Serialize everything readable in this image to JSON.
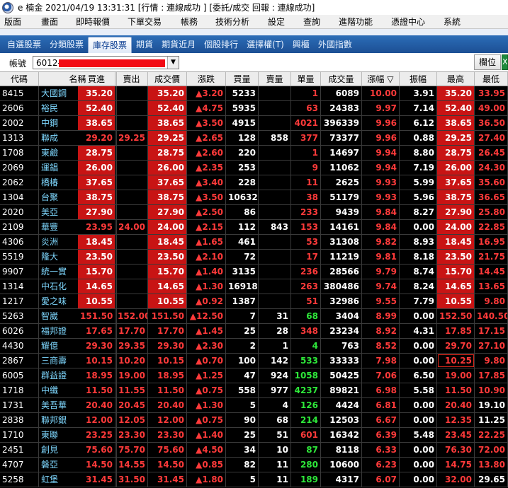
{
  "titlebar": {
    "title": "e 楠金  2021/04/19 13:31:31  [行情 : 連線成功  ] [委託/成交 回報 : 連線成功]"
  },
  "menu": [
    "版面",
    "畫面",
    "即時報價",
    "下單交易",
    "帳務",
    "技術分析",
    "設定",
    "查詢",
    "進階功能",
    "憑證中心",
    "系統"
  ],
  "tabs": [
    {
      "label": "自選股票",
      "active": false
    },
    {
      "label": "分類股票",
      "active": false
    },
    {
      "label": "庫存股票",
      "active": true
    },
    {
      "label": "期貨",
      "active": false
    },
    {
      "label": "期貨近月",
      "active": false
    },
    {
      "label": "個股排行",
      "active": false
    },
    {
      "label": "選擇權(T)",
      "active": false
    },
    {
      "label": "興櫃",
      "active": false
    },
    {
      "label": "外國指數",
      "active": false
    }
  ],
  "account": {
    "label": "帳號",
    "value": "6012-"
  },
  "toolbar": {
    "field_button": "欄位",
    "excel_glyph": "X"
  },
  "columns": [
    "代碼",
    "名稱",
    "買進",
    "賣出",
    "成交價",
    "漲跌",
    "買量",
    "賣量",
    "單量",
    "成交量",
    "漲幅 ▽",
    "振幅",
    "最高",
    "最低"
  ],
  "rows": [
    {
      "code": "8415",
      "name": "大國鋼",
      "bid": "35.20",
      "ask": "",
      "price": "35.20",
      "chg": "▲3.20",
      "bidq": "5233",
      "askq": "",
      "unit": "1",
      "vol": "6089",
      "pct": "10.00",
      "amp": "3.91",
      "high": "35.20",
      "low": "33.95",
      "lim": true
    },
    {
      "code": "2606",
      "name": "裕民",
      "bid": "52.40",
      "ask": "",
      "price": "52.40",
      "chg": "▲4.75",
      "bidq": "5935",
      "askq": "",
      "unit": "63",
      "vol": "24383",
      "pct": "9.97",
      "amp": "7.14",
      "high": "52.40",
      "low": "49.00",
      "lim": true
    },
    {
      "code": "2002",
      "name": "中鋼",
      "bid": "38.65",
      "ask": "",
      "price": "38.65",
      "chg": "▲3.50",
      "bidq": "4915",
      "askq": "",
      "unit": "4021",
      "vol": "396339",
      "pct": "9.96",
      "amp": "6.12",
      "high": "38.65",
      "low": "36.50",
      "lim": true
    },
    {
      "code": "1313",
      "name": "聯成",
      "bid": "29.20",
      "ask": "29.25",
      "price": "29.25",
      "chg": "▲2.65",
      "bidq": "128",
      "askq": "858",
      "unit": "377",
      "vol": "73377",
      "pct": "9.96",
      "amp": "0.88",
      "high": "29.25",
      "low": "27.40",
      "lim": true,
      "bidred": true
    },
    {
      "code": "1708",
      "name": "東鹼",
      "bid": "28.75",
      "ask": "",
      "price": "28.75",
      "chg": "▲2.60",
      "bidq": "220",
      "askq": "",
      "unit": "1",
      "vol": "14697",
      "pct": "9.94",
      "amp": "8.80",
      "high": "28.75",
      "low": "26.45",
      "lim": true
    },
    {
      "code": "2069",
      "name": "運錩",
      "bid": "26.00",
      "ask": "",
      "price": "26.00",
      "chg": "▲2.35",
      "bidq": "253",
      "askq": "",
      "unit": "9",
      "vol": "11062",
      "pct": "9.94",
      "amp": "7.19",
      "high": "26.00",
      "low": "24.30",
      "lim": true
    },
    {
      "code": "2062",
      "name": "橋椿",
      "bid": "37.65",
      "ask": "",
      "price": "37.65",
      "chg": "▲3.40",
      "bidq": "228",
      "askq": "",
      "unit": "11",
      "vol": "2625",
      "pct": "9.93",
      "amp": "5.99",
      "high": "37.65",
      "low": "35.60",
      "lim": true
    },
    {
      "code": "1304",
      "name": "台聚",
      "bid": "38.75",
      "ask": "",
      "price": "38.75",
      "chg": "▲3.50",
      "bidq": "10632",
      "askq": "",
      "unit": "38",
      "vol": "51179",
      "pct": "9.93",
      "amp": "5.96",
      "high": "38.75",
      "low": "36.65",
      "lim": true
    },
    {
      "code": "2020",
      "name": "美亞",
      "bid": "27.90",
      "ask": "",
      "price": "27.90",
      "chg": "▲2.50",
      "bidq": "86",
      "askq": "",
      "unit": "233",
      "vol": "9439",
      "pct": "9.84",
      "amp": "8.27",
      "high": "27.90",
      "low": "25.80",
      "lim": true
    },
    {
      "code": "2109",
      "name": "華豐",
      "bid": "23.95",
      "ask": "24.00",
      "price": "24.00",
      "chg": "▲2.15",
      "bidq": "112",
      "askq": "843",
      "unit": "153",
      "vol": "14161",
      "pct": "9.84",
      "amp": "0.00",
      "high": "24.00",
      "low": "22.85",
      "lim": true,
      "bidred": true
    },
    {
      "code": "4306",
      "name": "炎洲",
      "bid": "18.45",
      "ask": "",
      "price": "18.45",
      "chg": "▲1.65",
      "bidq": "461",
      "askq": "",
      "unit": "53",
      "vol": "31308",
      "pct": "9.82",
      "amp": "8.93",
      "high": "18.45",
      "low": "16.95",
      "lim": true
    },
    {
      "code": "5519",
      "name": "隆大",
      "bid": "23.50",
      "ask": "",
      "price": "23.50",
      "chg": "▲2.10",
      "bidq": "72",
      "askq": "",
      "unit": "17",
      "vol": "11219",
      "pct": "9.81",
      "amp": "8.18",
      "high": "23.50",
      "low": "21.75",
      "lim": true
    },
    {
      "code": "9907",
      "name": "統一實",
      "bid": "15.70",
      "ask": "",
      "price": "15.70",
      "chg": "▲1.40",
      "bidq": "3135",
      "askq": "",
      "unit": "236",
      "vol": "28566",
      "pct": "9.79",
      "amp": "8.74",
      "high": "15.70",
      "low": "14.45",
      "lim": true
    },
    {
      "code": "1314",
      "name": "中石化",
      "bid": "14.65",
      "ask": "",
      "price": "14.65",
      "chg": "▲1.30",
      "bidq": "16918",
      "askq": "",
      "unit": "263",
      "vol": "380486",
      "pct": "9.74",
      "amp": "8.24",
      "high": "14.65",
      "low": "13.65",
      "lim": true
    },
    {
      "code": "1217",
      "name": "愛之味",
      "bid": "10.55",
      "ask": "",
      "price": "10.55",
      "chg": "▲0.92",
      "bidq": "1387",
      "askq": "",
      "unit": "51",
      "vol": "32986",
      "pct": "9.55",
      "amp": "7.79",
      "high": "10.55",
      "low": "9.80",
      "lim": true
    },
    {
      "code": "5263",
      "name": "智崴",
      "bid": "151.50",
      "ask": "152.00",
      "price": "151.50",
      "chg": "▲12.50",
      "bidq": "7",
      "askq": "31",
      "unit": "68",
      "vol": "3404",
      "pct": "8.99",
      "amp": "0.00",
      "high": "152.50",
      "low": "140.50",
      "lim": false,
      "unitgreen": true,
      "lowred": true
    },
    {
      "code": "6026",
      "name": "福邦證",
      "bid": "17.65",
      "ask": "17.70",
      "price": "17.70",
      "chg": "▲1.45",
      "bidq": "25",
      "askq": "28",
      "unit": "348",
      "vol": "23234",
      "pct": "8.92",
      "amp": "4.31",
      "high": "17.85",
      "low": "17.15",
      "lim": false,
      "lowred": true
    },
    {
      "code": "4430",
      "name": "耀億",
      "bid": "29.30",
      "ask": "29.35",
      "price": "29.30",
      "chg": "▲2.30",
      "bidq": "2",
      "askq": "1",
      "unit": "4",
      "vol": "763",
      "pct": "8.52",
      "amp": "0.00",
      "high": "29.70",
      "low": "27.10",
      "lim": false,
      "unitgreen": true,
      "lowred": true
    },
    {
      "code": "2867",
      "name": "三商壽",
      "bid": "10.15",
      "ask": "10.20",
      "price": "10.15",
      "chg": "▲0.70",
      "bidq": "100",
      "askq": "142",
      "unit": "533",
      "vol": "33333",
      "pct": "7.98",
      "amp": "0.00",
      "high": "10.25",
      "low": "9.80",
      "lim": false,
      "unitgreen": true,
      "lowred": true,
      "highbox": true
    },
    {
      "code": "6005",
      "name": "群益證",
      "bid": "18.95",
      "ask": "19.00",
      "price": "18.95",
      "chg": "▲1.25",
      "bidq": "47",
      "askq": "924",
      "unit": "1058",
      "vol": "50425",
      "pct": "7.06",
      "amp": "6.50",
      "high": "19.00",
      "low": "17.85",
      "lim": false,
      "unitgreen": true,
      "lowred": true
    },
    {
      "code": "1718",
      "name": "中纖",
      "bid": "11.50",
      "ask": "11.55",
      "price": "11.50",
      "chg": "▲0.75",
      "bidq": "558",
      "askq": "977",
      "unit": "4237",
      "vol": "89821",
      "pct": "6.98",
      "amp": "5.58",
      "high": "11.50",
      "low": "10.90",
      "lim": false,
      "unitgreen": true,
      "lowred": true
    },
    {
      "code": "1731",
      "name": "美吾華",
      "bid": "20.40",
      "ask": "20.45",
      "price": "20.40",
      "chg": "▲1.30",
      "bidq": "5",
      "askq": "4",
      "unit": "126",
      "vol": "4424",
      "pct": "6.81",
      "amp": "0.00",
      "high": "20.40",
      "low": "19.10",
      "lim": false,
      "unitgreen": true,
      "lowwhite": true
    },
    {
      "code": "2838",
      "name": "聯邦銀",
      "bid": "12.00",
      "ask": "12.05",
      "price": "12.00",
      "chg": "▲0.75",
      "bidq": "90",
      "askq": "68",
      "unit": "214",
      "vol": "12503",
      "pct": "6.67",
      "amp": "0.00",
      "high": "12.35",
      "low": "11.25",
      "lim": false,
      "unitgreen": true,
      "lowwhite": true
    },
    {
      "code": "1710",
      "name": "東聯",
      "bid": "23.25",
      "ask": "23.30",
      "price": "23.30",
      "chg": "▲1.40",
      "bidq": "25",
      "askq": "51",
      "unit": "601",
      "vol": "16342",
      "pct": "6.39",
      "amp": "5.48",
      "high": "23.45",
      "low": "22.25",
      "lim": false,
      "lowred": true
    },
    {
      "code": "2451",
      "name": "創見",
      "bid": "75.60",
      "ask": "75.70",
      "price": "75.60",
      "chg": "▲4.50",
      "bidq": "34",
      "askq": "10",
      "unit": "87",
      "vol": "8118",
      "pct": "6.33",
      "amp": "0.00",
      "high": "76.30",
      "low": "72.00",
      "lim": false,
      "unitgreen": true,
      "lowred": true
    },
    {
      "code": "4707",
      "name": "磐亞",
      "bid": "14.50",
      "ask": "14.55",
      "price": "14.50",
      "chg": "▲0.85",
      "bidq": "82",
      "askq": "11",
      "unit": "280",
      "vol": "10600",
      "pct": "6.23",
      "amp": "0.00",
      "high": "14.75",
      "low": "13.80",
      "lim": false,
      "unitgreen": true,
      "lowred": true
    },
    {
      "code": "5258",
      "name": "虹堡",
      "bid": "31.45",
      "ask": "31.50",
      "price": "31.45",
      "chg": "▲1.80",
      "bidq": "5",
      "askq": "11",
      "unit": "189",
      "vol": "4317",
      "pct": "6.07",
      "amp": "0.00",
      "high": "32.00",
      "low": "29.65",
      "lim": false,
      "unitgreen": true,
      "lowwhite": true
    }
  ]
}
